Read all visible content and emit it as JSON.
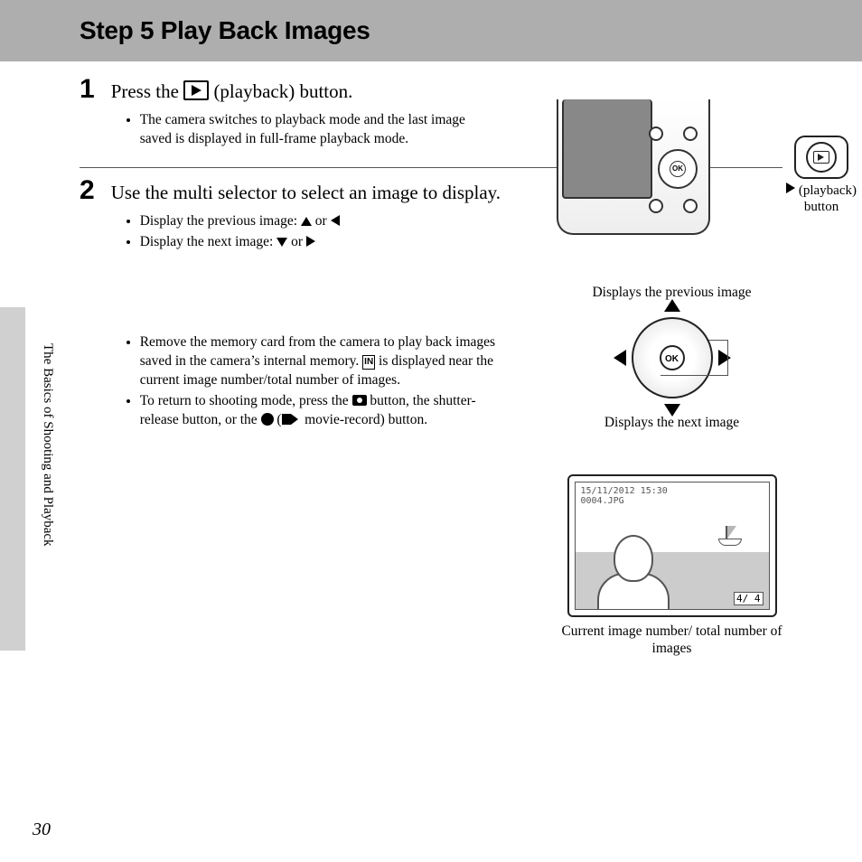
{
  "title": "Step 5 Play Back Images",
  "side_label": "The Basics of Shooting and Playback",
  "page_number": "30",
  "step1": {
    "num": "1",
    "title_pre": "Press the ",
    "title_post": " (playback) button.",
    "bullets": [
      "The camera switches to playback mode and the last image saved is displayed in full-frame playback mode."
    ],
    "callout_line1": "(playback)",
    "callout_line2": "button"
  },
  "step2": {
    "num": "2",
    "title": "Use the multi selector to select an image to display.",
    "bullets1_prev": "Display the previous image: ",
    "bullets1_next": "Display the next image: ",
    "or": " or ",
    "bullets2_a_pre": "Remove the memory card from the camera to play back images saved in the camera’s internal memory. ",
    "bullets2_a_post": " is displayed near the current image number/total number of images.",
    "bullets2_b_pre": "To return to shooting mode, press the ",
    "bullets2_b_mid": " button, the shutter-release button, or the ",
    "bullets2_b_post": " movie-record) button.",
    "selector_prev": "Displays the previous image",
    "selector_next": "Displays the next image",
    "ok": "OK",
    "osd_date": "15/11/2012  15:30",
    "osd_file": "0004.JPG",
    "counter": "4/     4",
    "caption": "Current image number/ total number of images"
  }
}
